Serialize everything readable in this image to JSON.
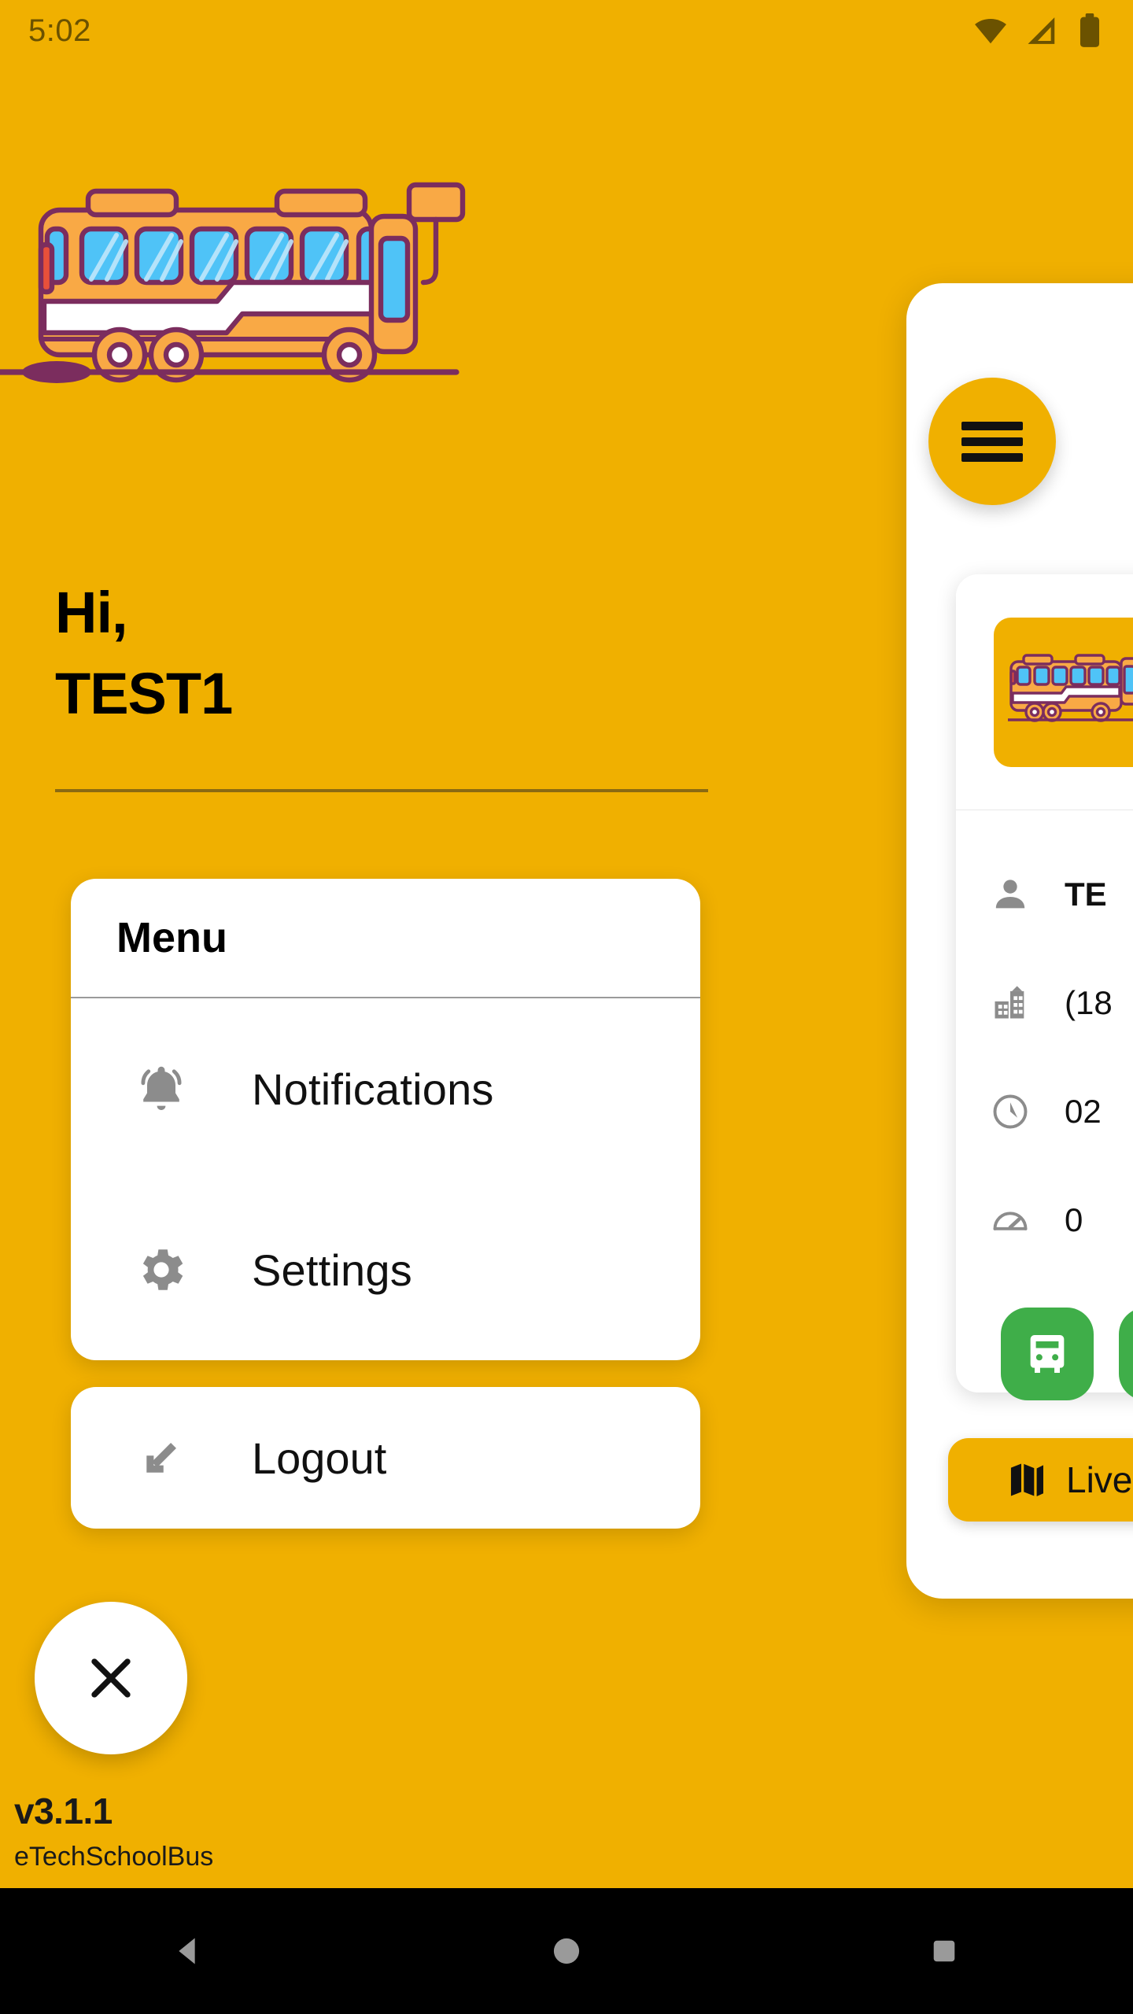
{
  "status_bar": {
    "time": "5:02",
    "icons": [
      "wifi-icon",
      "cellular-signal-icon",
      "battery-icon"
    ]
  },
  "theme": {
    "background": "#F0B000",
    "card_background": "#FFFFFF",
    "accent_green": "#3FAE49",
    "text_dark": "#000000",
    "icon_gray": "#8C8C8C",
    "divider": "#8A6A12"
  },
  "drawer": {
    "hero_illustration": "school-bus-illustration",
    "greeting_line1": "Hi,",
    "greeting_line2": "TEST1",
    "menu": {
      "title": "Menu",
      "items": [
        {
          "label": "Notifications",
          "icon": "bell-icon"
        },
        {
          "label": "Settings",
          "icon": "gear-icon"
        }
      ]
    },
    "logout": {
      "label": "Logout",
      "icon": "arrow-down-left-icon"
    },
    "close_button": {
      "icon": "close-icon"
    },
    "footer": {
      "version": "v3.1.1",
      "app_name": "eTechSchoolBus"
    }
  },
  "home_panel": {
    "menu_fab": {
      "icon": "hamburger-icon"
    },
    "bus_card": {
      "thumbnail": "school-bus-illustration",
      "rows": [
        {
          "icon": "person-icon",
          "value": "TE"
        },
        {
          "icon": "building-icon",
          "value": "(18"
        },
        {
          "icon": "clock-icon",
          "value": "02"
        },
        {
          "icon": "speedometer-icon",
          "value": "0"
        }
      ],
      "bus_button": {
        "icon": "bus-front-icon"
      }
    },
    "live_button": {
      "label": "Live",
      "icon": "map-icon"
    }
  },
  "nav_bar": {
    "buttons": [
      {
        "name": "back-button",
        "icon": "triangle-left-icon"
      },
      {
        "name": "home-button",
        "icon": "circle-icon"
      },
      {
        "name": "recents-button",
        "icon": "square-icon"
      }
    ]
  }
}
